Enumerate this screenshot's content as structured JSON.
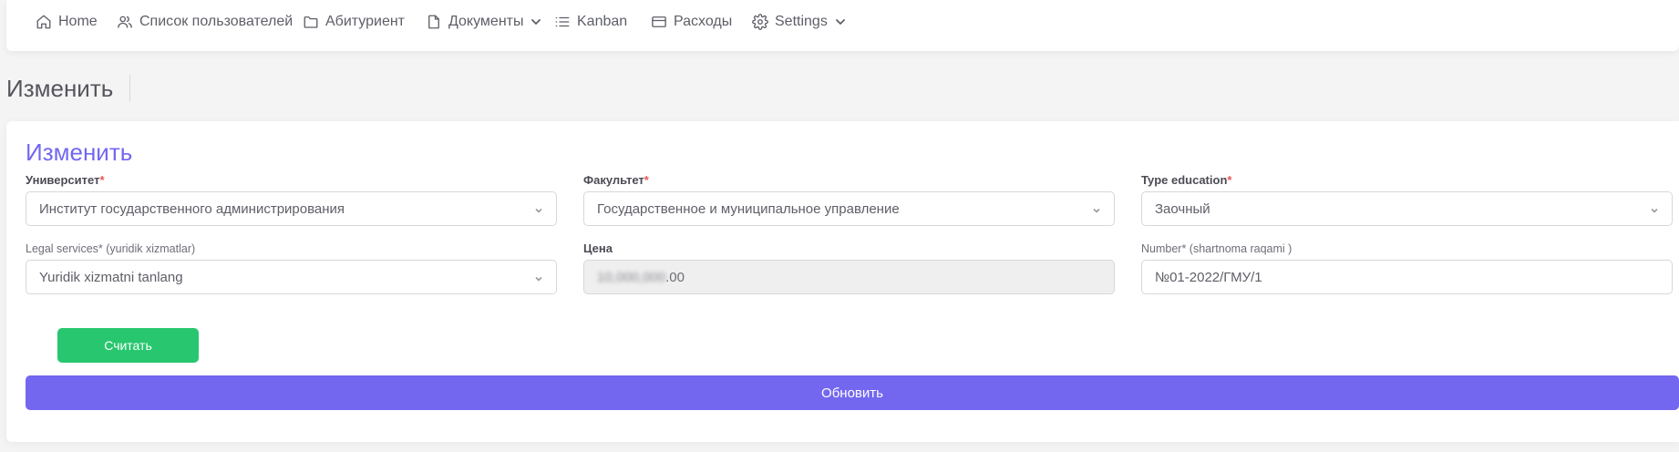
{
  "nav": {
    "items": [
      {
        "label": "Home",
        "icon": "home-icon"
      },
      {
        "label": "Список пользователей",
        "icon": "users-icon"
      },
      {
        "label": "Абитуриент",
        "icon": "folder-icon"
      },
      {
        "label": "Документы",
        "icon": "file-icon",
        "dropdown": true
      },
      {
        "label": "Kanban",
        "icon": "list-icon"
      },
      {
        "label": "Расходы",
        "icon": "credit-card-icon"
      },
      {
        "label": "Settings",
        "icon": "gear-icon",
        "dropdown": true
      }
    ]
  },
  "page": {
    "title": "Изменить"
  },
  "form": {
    "title": "Изменить",
    "university": {
      "label": "Университет",
      "required_mark": "*",
      "value": "Институт государственного администрирования"
    },
    "faculty": {
      "label": "Факультет",
      "required_mark": "*",
      "value": "Государственное и муниципальное управление"
    },
    "type_education": {
      "label": "Type education",
      "required_mark": "*",
      "value": "Заочный"
    },
    "legal_services": {
      "label": "Legal services* (yuridik xizmatlar)",
      "value": "Yuridik xizmatni tanlang"
    },
    "price": {
      "label": "Цена",
      "value_hidden": "10,000,000",
      "value_visible": ".00"
    },
    "number": {
      "label": "Number* (shartnoma raqami )",
      "value": "№01-2022/ГМУ/1"
    },
    "count_button": "Считать",
    "update_button": "Обновить"
  },
  "colors": {
    "accent": "#7367f0",
    "success": "#28c76f",
    "required": "#ea5455"
  }
}
